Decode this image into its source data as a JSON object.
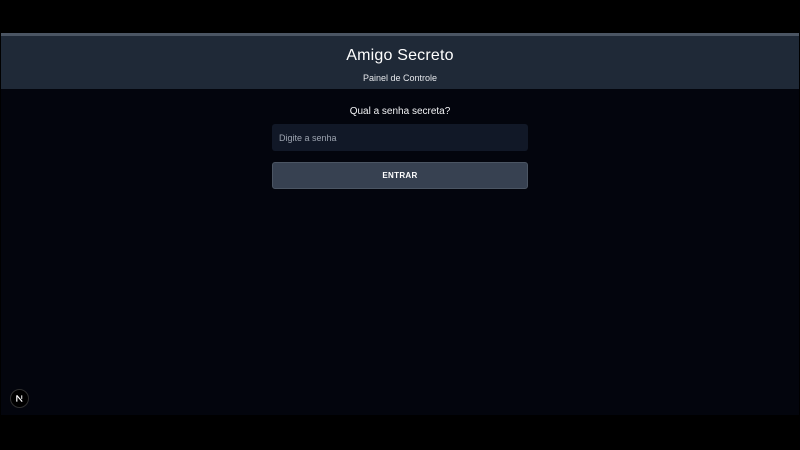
{
  "header": {
    "title": "Amigo Secreto",
    "subtitle": "Painel de Controle"
  },
  "login": {
    "prompt": "Qual a senha secreta?",
    "password_placeholder": "Digite a senha",
    "password_value": "",
    "submit_label": "ENTRAR"
  },
  "dev_indicator": {
    "icon": "nextjs-logo-icon"
  },
  "colors": {
    "page_background": "#03050d",
    "header_background": "#1f2937",
    "input_background": "#111827",
    "button_background": "#374151"
  }
}
